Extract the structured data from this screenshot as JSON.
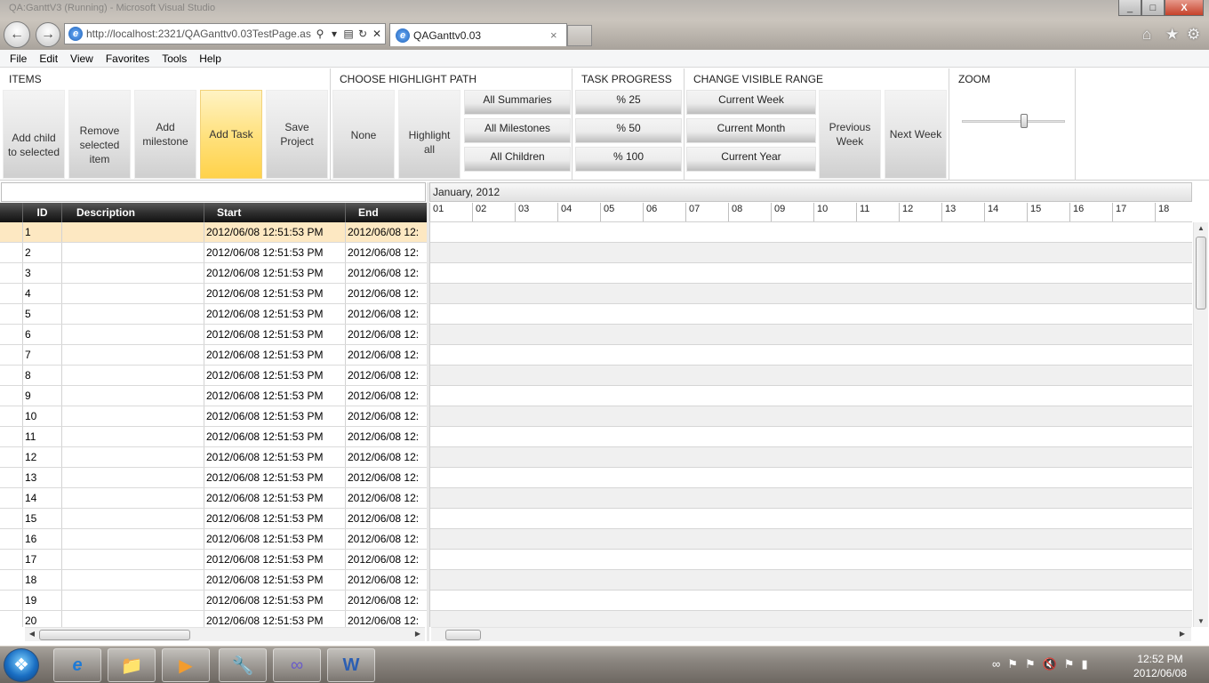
{
  "window": {
    "title": "QA:GanttV3 (Running) - Microsoft Visual Studio",
    "buttons": [
      "_",
      "□",
      "X"
    ]
  },
  "browser": {
    "back_icon": "back-arrow-icon",
    "forward_icon": "forward-arrow-icon",
    "url": "http://localhost:2321/QAGanttv0.03TestPage.as",
    "tab_title": "QAGanttv0.03",
    "tab_close": "×"
  },
  "menu": [
    "File",
    "Edit",
    "View",
    "Favorites",
    "Tools",
    "Help"
  ],
  "ribbon": {
    "items": {
      "title": "ITEMS",
      "buttons": [
        "Add child to selected",
        "Remove selected item",
        "Add milestone",
        "Add Task",
        "Save Project"
      ]
    },
    "highlight": {
      "title": "CHOOSE HIGHLIGHT PATH",
      "buttons": [
        "None",
        "Highlight all"
      ],
      "options": [
        "All Summaries",
        "All Milestones",
        "All Children"
      ]
    },
    "progress": {
      "title": "TASK PROGRESS",
      "buttons": [
        "% 25",
        "% 50",
        "% 100"
      ]
    },
    "range": {
      "title": "CHANGE VISIBLE RANGE",
      "options": [
        "Current Week",
        "Current Month",
        "Current Year"
      ],
      "buttons": [
        "Previous Week",
        "Next Week"
      ]
    },
    "zoom": {
      "title": "ZOOM",
      "level": 0.6
    }
  },
  "grid": {
    "columns": [
      "ID",
      "Description",
      "Start",
      "End"
    ],
    "rows": [
      {
        "id": "1",
        "description": "",
        "start": "2012/06/08 12:51:53 PM",
        "end": "2012/06/08 12:"
      },
      {
        "id": "2",
        "description": "",
        "start": "2012/06/08 12:51:53 PM",
        "end": "2012/06/08 12:"
      },
      {
        "id": "3",
        "description": "",
        "start": "2012/06/08 12:51:53 PM",
        "end": "2012/06/08 12:"
      },
      {
        "id": "4",
        "description": "",
        "start": "2012/06/08 12:51:53 PM",
        "end": "2012/06/08 12:"
      },
      {
        "id": "5",
        "description": "",
        "start": "2012/06/08 12:51:53 PM",
        "end": "2012/06/08 12:"
      },
      {
        "id": "6",
        "description": "",
        "start": "2012/06/08 12:51:53 PM",
        "end": "2012/06/08 12:"
      },
      {
        "id": "7",
        "description": "",
        "start": "2012/06/08 12:51:53 PM",
        "end": "2012/06/08 12:"
      },
      {
        "id": "8",
        "description": "",
        "start": "2012/06/08 12:51:53 PM",
        "end": "2012/06/08 12:"
      },
      {
        "id": "9",
        "description": "",
        "start": "2012/06/08 12:51:53 PM",
        "end": "2012/06/08 12:"
      },
      {
        "id": "10",
        "description": "",
        "start": "2012/06/08 12:51:53 PM",
        "end": "2012/06/08 12:"
      },
      {
        "id": "11",
        "description": "",
        "start": "2012/06/08 12:51:53 PM",
        "end": "2012/06/08 12:"
      },
      {
        "id": "12",
        "description": "",
        "start": "2012/06/08 12:51:53 PM",
        "end": "2012/06/08 12:"
      },
      {
        "id": "13",
        "description": "",
        "start": "2012/06/08 12:51:53 PM",
        "end": "2012/06/08 12:"
      },
      {
        "id": "14",
        "description": "",
        "start": "2012/06/08 12:51:53 PM",
        "end": "2012/06/08 12:"
      },
      {
        "id": "15",
        "description": "",
        "start": "2012/06/08 12:51:53 PM",
        "end": "2012/06/08 12:"
      },
      {
        "id": "16",
        "description": "",
        "start": "2012/06/08 12:51:53 PM",
        "end": "2012/06/08 12:"
      },
      {
        "id": "17",
        "description": "",
        "start": "2012/06/08 12:51:53 PM",
        "end": "2012/06/08 12:"
      },
      {
        "id": "18",
        "description": "",
        "start": "2012/06/08 12:51:53 PM",
        "end": "2012/06/08 12:"
      },
      {
        "id": "19",
        "description": "",
        "start": "2012/06/08 12:51:53 PM",
        "end": "2012/06/08 12:"
      },
      {
        "id": "20",
        "description": "",
        "start": "2012/06/08 12:51:53 PM",
        "end": "2012/06/08 12:"
      }
    ],
    "selected_id": "1"
  },
  "gantt": {
    "month": "January, 2012",
    "days": [
      "01",
      "02",
      "03",
      "04",
      "05",
      "06",
      "07",
      "08",
      "09",
      "10",
      "11",
      "12",
      "13",
      "14",
      "15",
      "16",
      "17",
      "18"
    ]
  },
  "taskbar": {
    "apps": [
      "internet-explorer",
      "windows-explorer",
      "media-player",
      "visual-studio-tools",
      "visual-studio",
      "microsoft-word"
    ],
    "tray_icons": [
      "network-icon",
      "security-icon",
      "update-icon",
      "volume-muted-icon",
      "network-error-icon",
      "signal-icon"
    ],
    "time": "12:52 PM",
    "date": "2012/06/08"
  }
}
